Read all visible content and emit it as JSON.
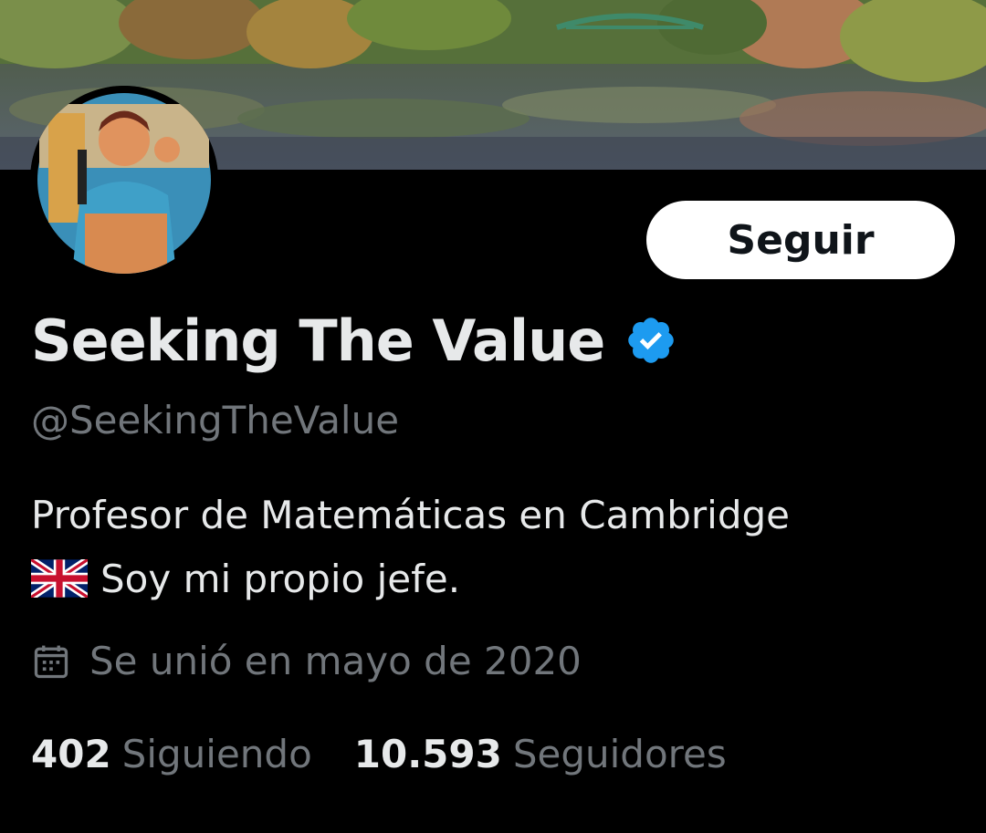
{
  "profile": {
    "display_name": "Seeking The Value",
    "handle": "@SeekingTheValue",
    "verified": true,
    "bio_line1": "Profesor de Matemáticas en Cambridge",
    "bio_line2": "Soy mi propio jefe.",
    "joined": "Se unió en mayo de 2020"
  },
  "actions": {
    "follow_label": "Seguir"
  },
  "stats": {
    "following_count": "402",
    "following_label": "Siguiendo",
    "followers_count": "10.593",
    "followers_label": "Seguidores"
  },
  "icons": {
    "verified": "verified-badge-icon",
    "flag": "uk-flag-icon",
    "calendar": "calendar-icon"
  },
  "colors": {
    "background": "#000000",
    "primary_text": "#e7e9ea",
    "secondary_text": "#71767b",
    "verified_blue": "#1d9bf0",
    "button_bg": "#ffffff",
    "button_text": "#0f1419"
  }
}
